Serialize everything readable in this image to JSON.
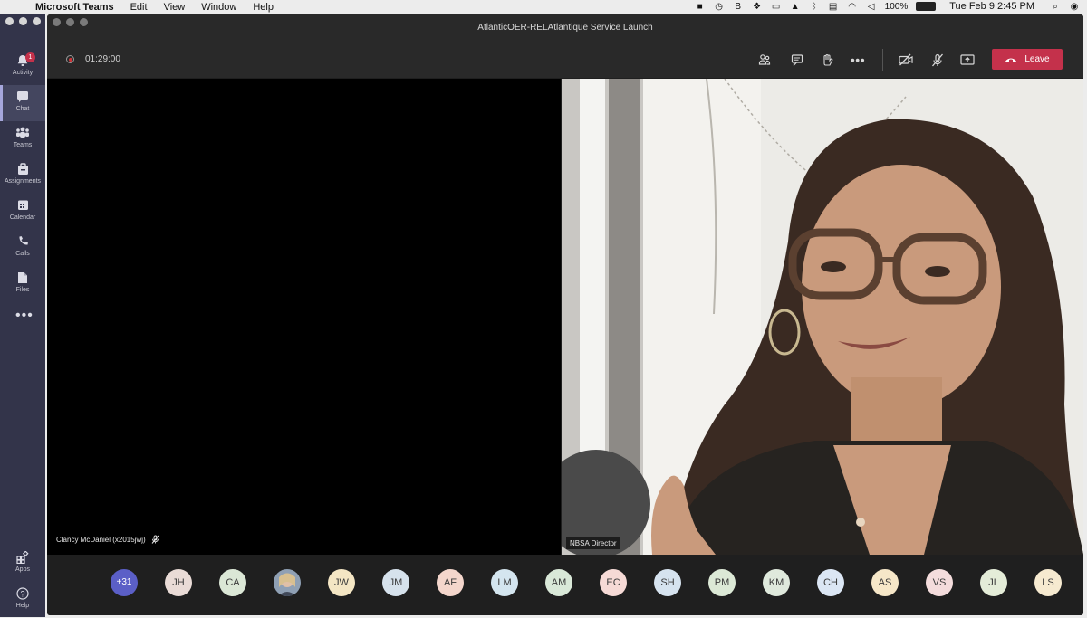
{
  "menubar": {
    "app": "Microsoft Teams",
    "menus": [
      "Edit",
      "View",
      "Window",
      "Help"
    ],
    "battery": "100%",
    "clock": "Tue Feb 9  2:45 PM"
  },
  "rail": {
    "items": [
      {
        "label": "Activity",
        "icon": "bell-icon",
        "badge": "1"
      },
      {
        "label": "Chat",
        "icon": "chat-icon"
      },
      {
        "label": "Teams",
        "icon": "teams-icon"
      },
      {
        "label": "Assignments",
        "icon": "assignments-icon"
      },
      {
        "label": "Calendar",
        "icon": "calendar-icon"
      },
      {
        "label": "Calls",
        "icon": "phone-icon"
      },
      {
        "label": "Files",
        "icon": "file-icon"
      }
    ],
    "bottom": [
      {
        "label": "Apps",
        "icon": "apps-icon"
      },
      {
        "label": "Help",
        "icon": "help-icon"
      }
    ]
  },
  "window": {
    "title": "AtlanticOER-RELAtlantique Service Launch"
  },
  "meeting": {
    "timer": "01:29:00",
    "leave_label": "Leave",
    "leave_color": "#c4314b"
  },
  "tiles": {
    "left_name": "Clancy McDaniel (x2015jwj)",
    "right_name": "NBSA Director"
  },
  "roster": {
    "overflow": "+31",
    "participants": [
      {
        "initials": "JH",
        "color": "#e9dbd6"
      },
      {
        "initials": "CA",
        "color": "#dbe7d6"
      },
      {
        "initials": "",
        "color": "#8a9ab0",
        "photo": true
      },
      {
        "initials": "JW",
        "color": "#f4e6c4"
      },
      {
        "initials": "JM",
        "color": "#d6e2ec"
      },
      {
        "initials": "AF",
        "color": "#f4d6cc"
      },
      {
        "initials": "LM",
        "color": "#d4e5ef"
      },
      {
        "initials": "AM",
        "color": "#d9e8d8"
      },
      {
        "initials": "EC",
        "color": "#f6dad6"
      },
      {
        "initials": "SH",
        "color": "#d6e3ef"
      },
      {
        "initials": "PM",
        "color": "#dce9d6"
      },
      {
        "initials": "KM",
        "color": "#dfe9dc"
      },
      {
        "initials": "CH",
        "color": "#dbe6f4"
      },
      {
        "initials": "AS",
        "color": "#f6e7c8"
      },
      {
        "initials": "VS",
        "color": "#f4dcdc"
      },
      {
        "initials": "JL",
        "color": "#e4ecd8"
      },
      {
        "initials": "LS",
        "color": "#f6ead0"
      }
    ]
  }
}
